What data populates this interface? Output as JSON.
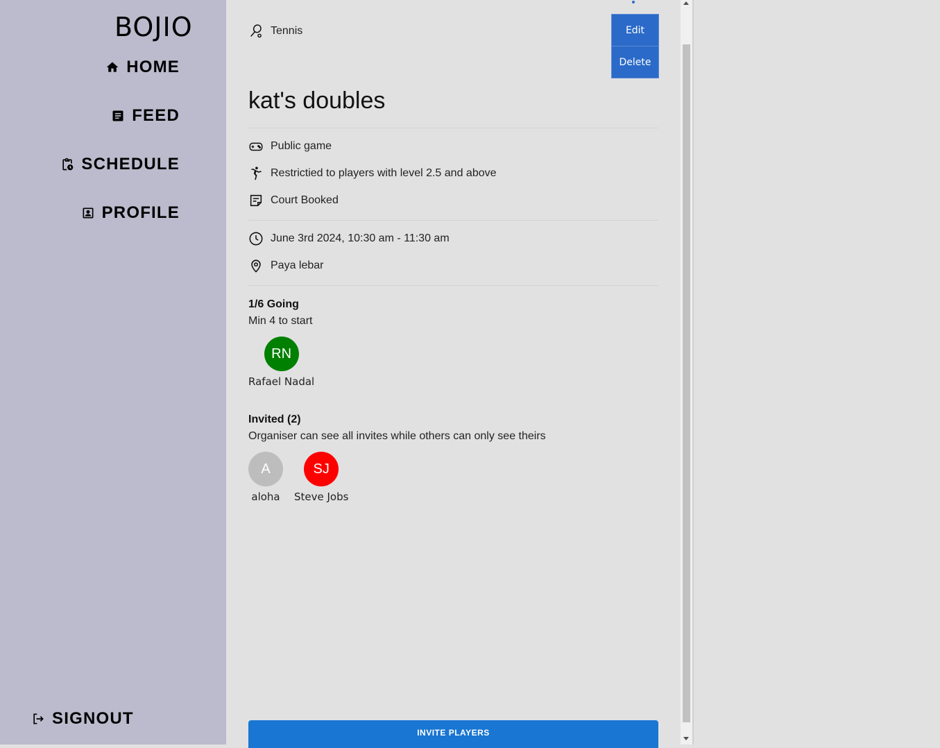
{
  "sidebar": {
    "brand": "BOJIO",
    "items": [
      {
        "label": "HOME",
        "icon": "home-icon"
      },
      {
        "label": "FEED",
        "icon": "feed-icon"
      },
      {
        "label": "SCHEDULE",
        "icon": "schedule-icon"
      },
      {
        "label": "PROFILE",
        "icon": "profile-icon"
      }
    ],
    "signout": "SIGNOUT"
  },
  "game": {
    "sport": "Tennis",
    "title": "kat's doubles",
    "visibility": "Public game",
    "restriction": "Restrictied to players with level 2.5 and above",
    "booking": "Court Booked",
    "datetime": "June 3rd 2024, 10:30 am - 11:30 am",
    "location": "Paya lebar"
  },
  "actions": {
    "edit": "Edit",
    "delete": "Delete",
    "invite": "INVITE PLAYERS"
  },
  "going": {
    "title": "1/6 Going",
    "subtitle": "Min 4 to start",
    "players": [
      {
        "initials": "RN",
        "name": "Rafael Nadal",
        "color": "#008000"
      }
    ]
  },
  "invited": {
    "title": "Invited (2)",
    "subtitle": "Organiser can see all invites while others can only see theirs",
    "players": [
      {
        "initials": "A",
        "name": "aloha",
        "color": "#bdbdbd"
      },
      {
        "initials": "SJ",
        "name": "Steve Jobs",
        "color": "#ff0000"
      }
    ]
  },
  "colors": {
    "sidebar_bg": "#bcbbcd",
    "main_bg": "#e1e1e2",
    "button_blue": "#2b6ac8",
    "invite_blue": "#1976d2"
  }
}
